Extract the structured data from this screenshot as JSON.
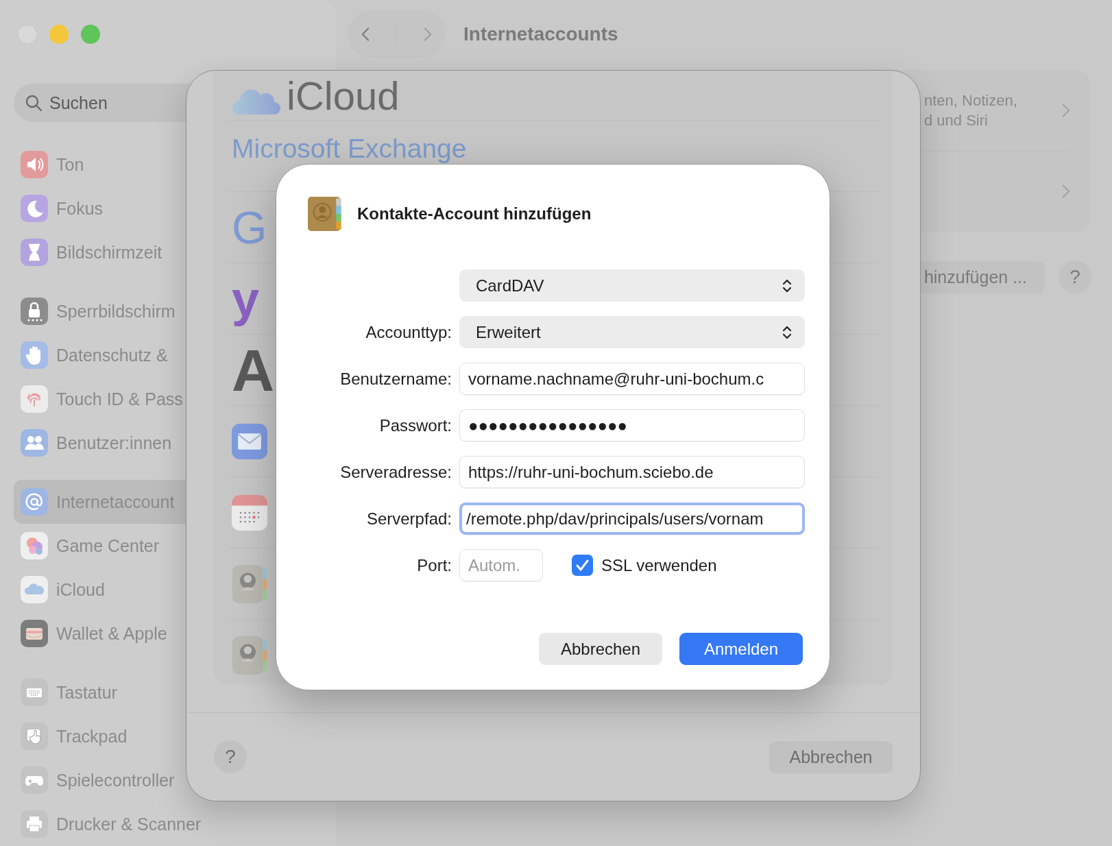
{
  "window": {
    "title": "Internetaccounts"
  },
  "sidebar": {
    "search": {
      "placeholder": "Suchen"
    },
    "groups": [
      {
        "items": [
          {
            "label": "Ton",
            "selected": false
          },
          {
            "label": "Fokus",
            "selected": false
          },
          {
            "label": "Bildschirmzeit",
            "selected": false
          }
        ]
      },
      {
        "items": [
          {
            "label": "Sperrbildschirm",
            "selected": false
          },
          {
            "label": "Datenschutz &",
            "selected": false
          },
          {
            "label": "Touch ID & Pass",
            "selected": false
          },
          {
            "label": "Benutzer:innen",
            "selected": false
          }
        ]
      },
      {
        "items": [
          {
            "label": "Internetaccount",
            "selected": true
          },
          {
            "label": "Game Center",
            "selected": false
          },
          {
            "label": "iCloud",
            "selected": false
          },
          {
            "label": "Wallet & Apple",
            "selected": false
          }
        ]
      },
      {
        "items": [
          {
            "label": "Tastatur",
            "selected": false
          },
          {
            "label": "Trackpad",
            "selected": false
          },
          {
            "label": "Spielecontroller",
            "selected": false
          },
          {
            "label": "Drucker & Scanner",
            "selected": false
          }
        ]
      }
    ]
  },
  "content": {
    "description": [
      "nten, Notizen,",
      "d und Siri"
    ],
    "add_button": "hinzufügen ...",
    "help_button": "?"
  },
  "sheet": {
    "providers": [
      {
        "kind": "icloud",
        "label": "iCloud"
      },
      {
        "kind": "exchange",
        "label": "Microsoft Exchange"
      },
      {
        "kind": "google",
        "label": "G"
      },
      {
        "kind": "yahoo",
        "label": "y"
      },
      {
        "kind": "aol",
        "label": "A"
      },
      {
        "kind": "mail"
      },
      {
        "kind": "calendar"
      },
      {
        "kind": "contacts"
      },
      {
        "kind": "contacts"
      }
    ],
    "help_button": "?",
    "cancel_button": "Abbrechen"
  },
  "dialog": {
    "title": "Kontakte-Account hinzufügen",
    "fields": [
      {
        "kind": "select",
        "value": "CardDAV"
      },
      {
        "kind": "select",
        "label": "Accounttyp:",
        "value": "Erweitert"
      },
      {
        "kind": "text",
        "label": "Benutzername:",
        "value": "vorname.nachname@ruhr-uni-bochum.c",
        "focused": false
      },
      {
        "kind": "text",
        "label": "Passwort:",
        "value": "●●●●●●●●●●●●●●●●",
        "focused": false
      },
      {
        "kind": "text",
        "label": "Serveradresse:",
        "value": "https://ruhr-uni-bochum.sciebo.de",
        "focused": false
      },
      {
        "kind": "text",
        "label": "Serverpfad:",
        "value": "/remote.php/dav/principals/users/vornam",
        "focused": true
      }
    ],
    "port": {
      "label": "Port:",
      "placeholder": "Autom."
    },
    "ssl": {
      "label": "SSL verwenden",
      "checked": true
    },
    "buttons": [
      {
        "kind": "secondary",
        "label": "Abbrechen"
      },
      {
        "kind": "primary",
        "label": "Anmelden"
      }
    ]
  }
}
